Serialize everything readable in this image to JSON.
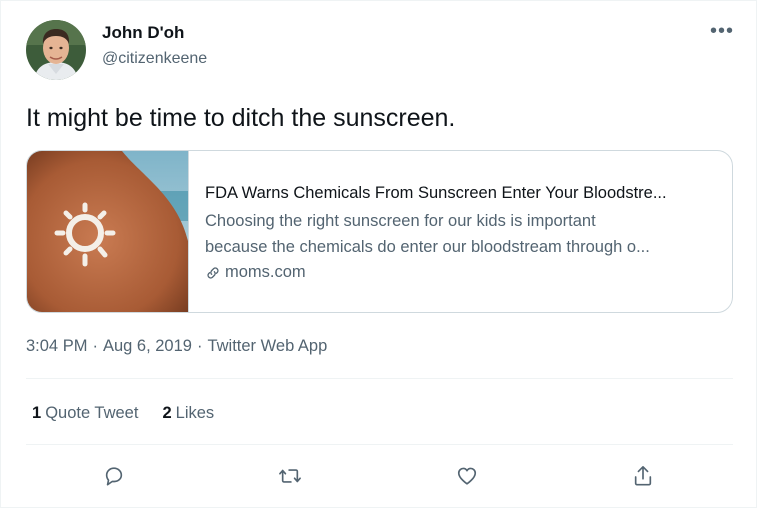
{
  "author": {
    "name": "John D'oh",
    "handle": "@citizenkeene",
    "avatar_icon": "profile-photo"
  },
  "more_icon": "more-horizontal-icon",
  "more_label": "•••",
  "tweet": {
    "text": "It might be time to ditch the sunscreen."
  },
  "card": {
    "image_icon": "sunscreen-sun-on-shoulder-image",
    "title": "FDA Warns Chemicals From Sunscreen Enter Your Bloodstre...",
    "description_line1": "Choosing the right sunscreen for our kids is important",
    "description_line2": "because the chemicals do enter our bloodstream through o...",
    "domain": "moms.com",
    "domain_icon": "link-icon"
  },
  "meta": {
    "time": "3:04 PM",
    "separator": "·",
    "date": "Aug 6, 2019",
    "source": "Twitter Web App"
  },
  "stats": {
    "quote_count": "1",
    "quote_label": "Quote Tweet",
    "like_count": "2",
    "like_label": "Likes"
  },
  "actions": [
    "reply-icon",
    "retweet-icon",
    "like-icon",
    "share-icon"
  ],
  "colors": {
    "text": "#0f1419",
    "secondary": "#536471",
    "border": "#cfd9de",
    "divider": "#eff3f4"
  }
}
